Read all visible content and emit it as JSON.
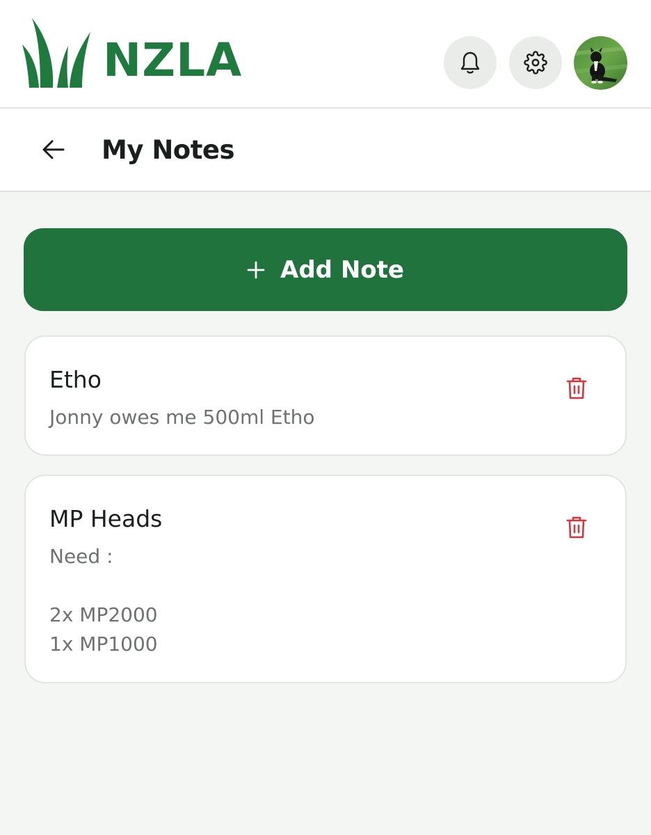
{
  "header": {
    "logo_text": "NZLA",
    "icons": {
      "logo": "grass-logo-icon",
      "notifications": "bell-icon",
      "settings": "gear-icon",
      "avatar": "user-avatar-dog-photo"
    }
  },
  "subheader": {
    "back_icon": "arrow-left-icon",
    "title": "My Notes"
  },
  "add_button": {
    "icon": "plus-icon",
    "label": "Add Note"
  },
  "notes": [
    {
      "title": "Etho",
      "body": "Jonny owes me 500ml Etho",
      "delete_icon": "trash-icon"
    },
    {
      "title": "MP Heads",
      "body": "Need :\n\n2x MP2000\n1x MP1000",
      "delete_icon": "trash-icon"
    }
  ],
  "colors": {
    "brand_green": "#1f7a3e",
    "button_green": "#20733c",
    "delete_red": "#d6363b",
    "background": "#f4f6f4"
  }
}
